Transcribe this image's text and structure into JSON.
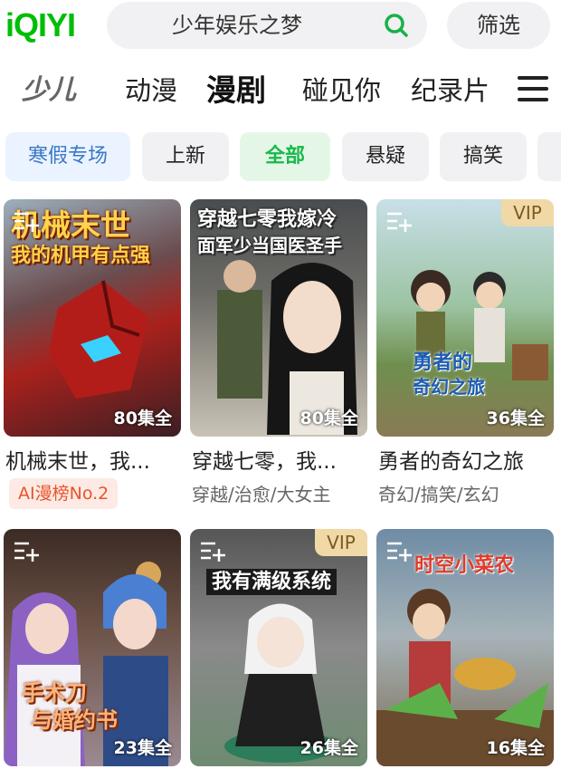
{
  "header": {
    "logo": "iQIYI",
    "search_placeholder": "少年娱乐之梦",
    "filter_label": "筛选"
  },
  "channels": {
    "kids": "少儿",
    "items": [
      "动漫",
      "漫剧",
      "碰见你",
      "纪录片"
    ],
    "active": "漫剧"
  },
  "chips": [
    "寒假专场",
    "上新",
    "全部",
    "悬疑",
    "搞笑"
  ],
  "cards": [
    {
      "poster_text": [
        "机械末世",
        "我的机甲有点强"
      ],
      "episodes": "80集全",
      "title": "机械末世，我...",
      "badge": "AI漫榜No.2",
      "vip": false
    },
    {
      "poster_text": [
        "穿越七零我嫁冷",
        "面军少当国医圣手"
      ],
      "episodes": "80集全",
      "title": "穿越七零，我...",
      "tags": "穿越/治愈/大女主",
      "vip": false
    },
    {
      "poster_text": [
        "勇者的",
        "奇幻之旅"
      ],
      "episodes": "36集全",
      "title": "勇者的奇幻之旅",
      "tags": "奇幻/搞笑/玄幻",
      "vip": true,
      "vip_label": "VIP"
    },
    {
      "poster_text": [
        "手术刀",
        "与婚约书"
      ],
      "episodes": "23集全",
      "vip": false
    },
    {
      "poster_text": [
        "我有满级系统"
      ],
      "episodes": "26集全",
      "vip": true,
      "vip_label": "VIP"
    },
    {
      "poster_text": [
        "时空小菜农"
      ],
      "episodes": "16集全",
      "vip": false
    }
  ],
  "colors": {
    "brand": "#00be06",
    "active_chip": "#19b84b",
    "promo_chip": "#3b78c4",
    "badge": "#e8542a",
    "vip_bg": "#f1d9a7"
  }
}
